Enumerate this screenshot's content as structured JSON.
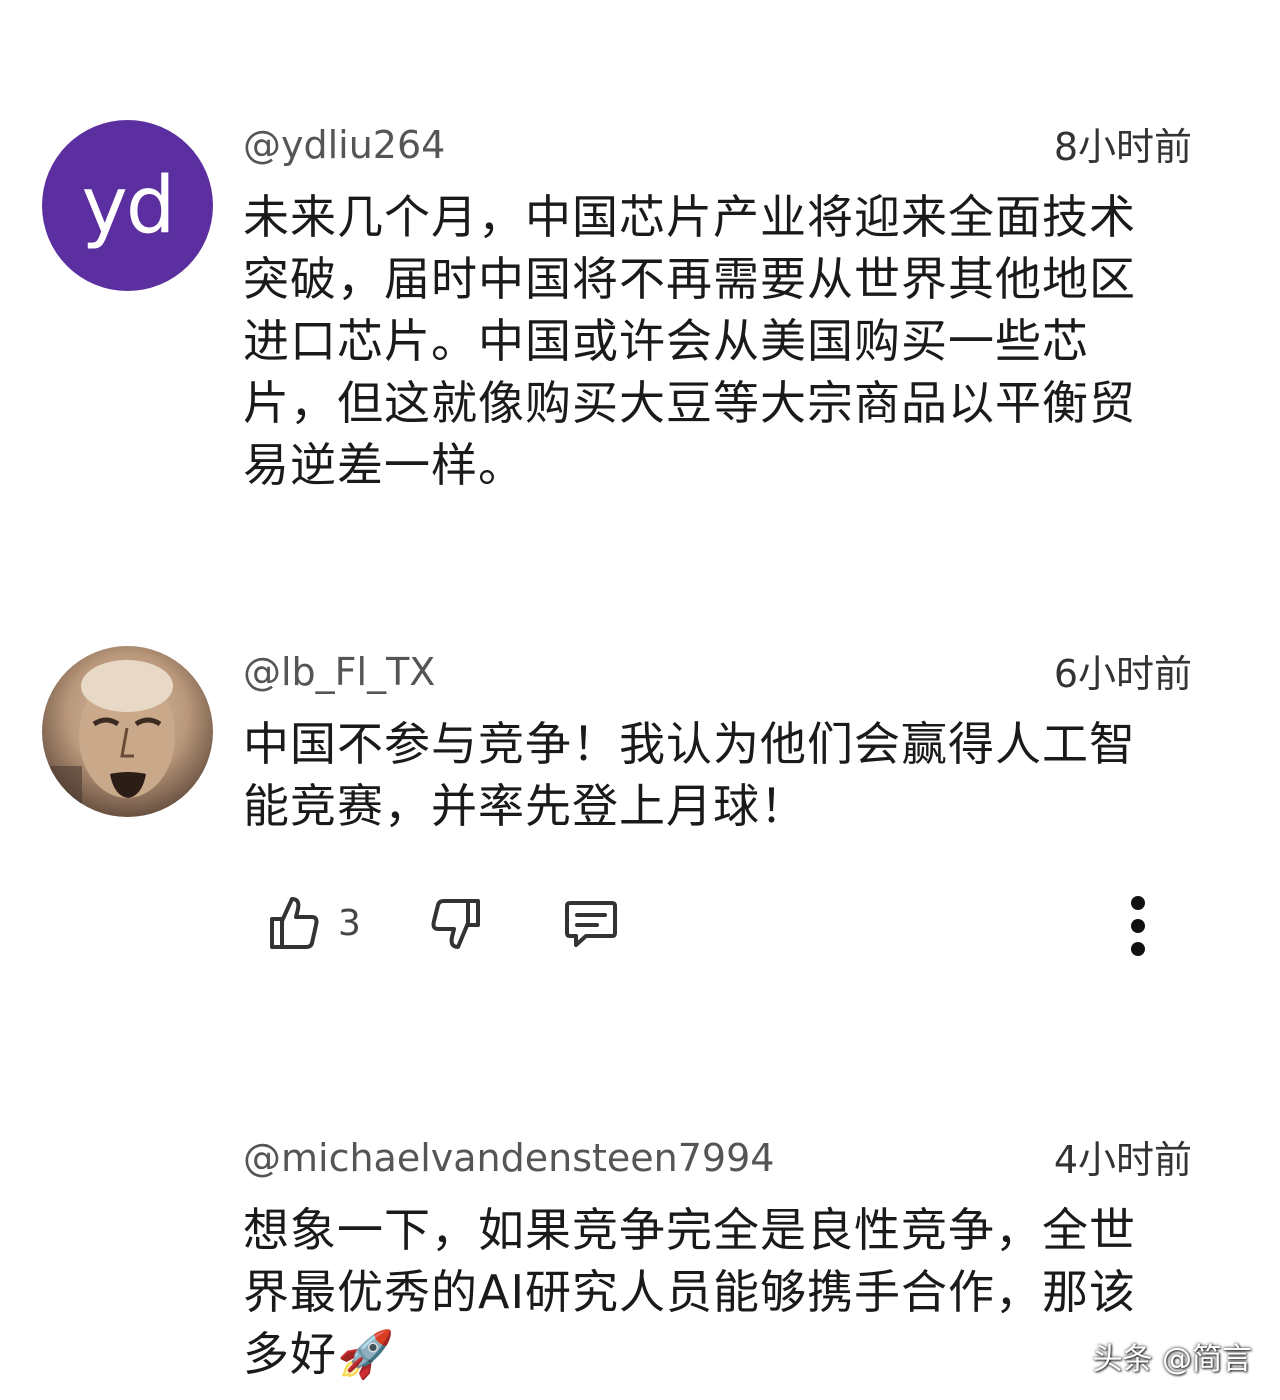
{
  "comments": [
    {
      "avatar_initials": "yd",
      "avatar_color": "#5b2fa0",
      "handle": "@ydliu264",
      "time": "8小时前",
      "lines": [
        "未来几个月，中国芯片产业将迎来全面技术",
        "突破，届时中国将不再需要从世界其他地区",
        "进口芯片。中国或许会从美国购买一些芯",
        "片，但这就像购买大豆等大宗商品以平衡贸",
        "易逆差一样。"
      ]
    },
    {
      "avatar_icon": "profile-photo",
      "handle": "@lb_Fl_TX",
      "time": "6小时前",
      "lines": [
        "中国不参与竞争！我认为他们会赢得人工智",
        "能竞赛，并率先登上月球！"
      ],
      "actions": {
        "like_icon": "thumbs-up-icon",
        "like_count": "3",
        "dislike_icon": "thumbs-down-icon",
        "reply_icon": "comment-icon",
        "more_icon": "more-vertical-icon"
      }
    },
    {
      "handle": "@michaelvandensteen7994",
      "time": "4小时前",
      "lines": [
        "想象一下，如果竞争完全是良性竞争，全世",
        "界最优秀的AI研究人员能够携手合作，那该",
        "多好🚀"
      ]
    }
  ],
  "watermark": "头条 @简言"
}
